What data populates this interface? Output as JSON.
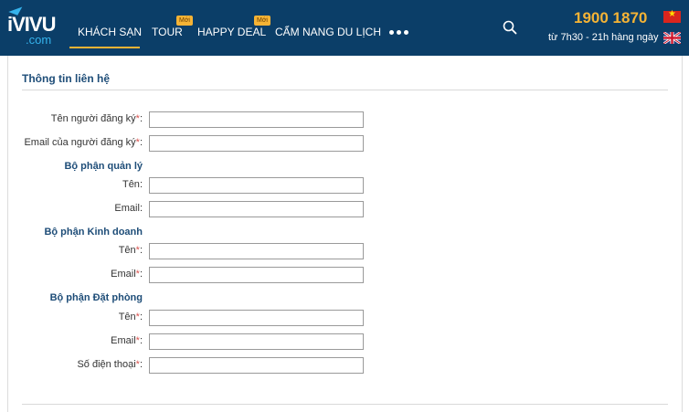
{
  "header": {
    "logo": {
      "word": "iVIVU",
      "suffix": ".com"
    },
    "nav": [
      {
        "label": "KHÁCH SẠN",
        "badge": ""
      },
      {
        "label": "TOUR",
        "badge": "Mới"
      },
      {
        "label": "HAPPY DEAL",
        "badge": "Mới"
      },
      {
        "label": "CẨM NANG DU LỊCH",
        "badge": ""
      }
    ],
    "more_icon": "more-dots-icon",
    "search_icon": "search-icon",
    "hotline": "1900 1870",
    "hours": "từ 7h30 - 21h hàng ngày",
    "colors": {
      "header_bg": "#0b3e68",
      "accent": "#f5b335",
      "title": "#1e4d78",
      "required": "#d9534f"
    }
  },
  "form": {
    "section_title": "Thông tin liên hệ",
    "required_mark": "*",
    "registrant": {
      "name_label": "Tên người đăng ký",
      "email_label": "Email của người đăng ký",
      "name_value": "",
      "email_value": ""
    },
    "management": {
      "title": "Bộ phận quản lý",
      "name_label": "Tên",
      "email_label": "Email"
    },
    "sales": {
      "title": "Bộ phận Kinh doanh",
      "name_label": "Tên",
      "email_label": "Email"
    },
    "booking": {
      "title": "Bộ phận Đặt phòng",
      "name_label": "Tên",
      "email_label": "Email",
      "phone_label": "Số điện thoại"
    },
    "colon": ":"
  }
}
